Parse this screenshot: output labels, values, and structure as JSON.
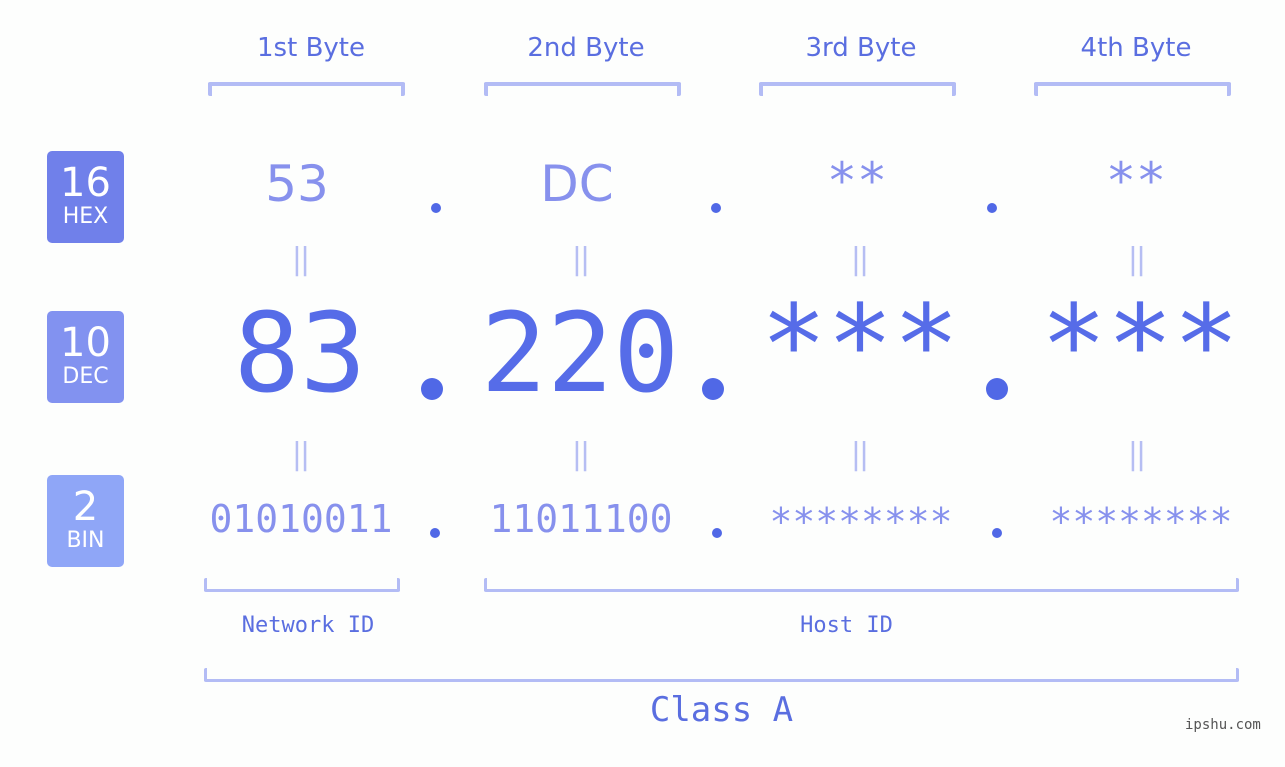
{
  "bytes": [
    {
      "label": "1st Byte",
      "hex": "53",
      "dec": "83",
      "bin": "01010011"
    },
    {
      "label": "2nd Byte",
      "hex": "DC",
      "dec": "220",
      "bin": "11011100"
    },
    {
      "label": "3rd Byte",
      "hex": "**",
      "dec": "***",
      "bin": "********"
    },
    {
      "label": "4th Byte",
      "hex": "**",
      "dec": "***",
      "bin": "********"
    }
  ],
  "bases": [
    {
      "num": "16",
      "label": "HEX",
      "color": "#7080ea"
    },
    {
      "num": "10",
      "label": "DEC",
      "color": "#8292f0"
    },
    {
      "num": "2",
      "label": "BIN",
      "color": "#8fa6f7"
    }
  ],
  "separator": ".",
  "equals": "||",
  "sections": {
    "network": "Network ID",
    "host": "Host ID",
    "class": "Class A"
  },
  "watermark": "ipshu.com",
  "colors": {
    "accent": "#566ce8",
    "light_value": "#8791ed",
    "bracket": "#b3bcf5",
    "dot": "#5068e6"
  }
}
